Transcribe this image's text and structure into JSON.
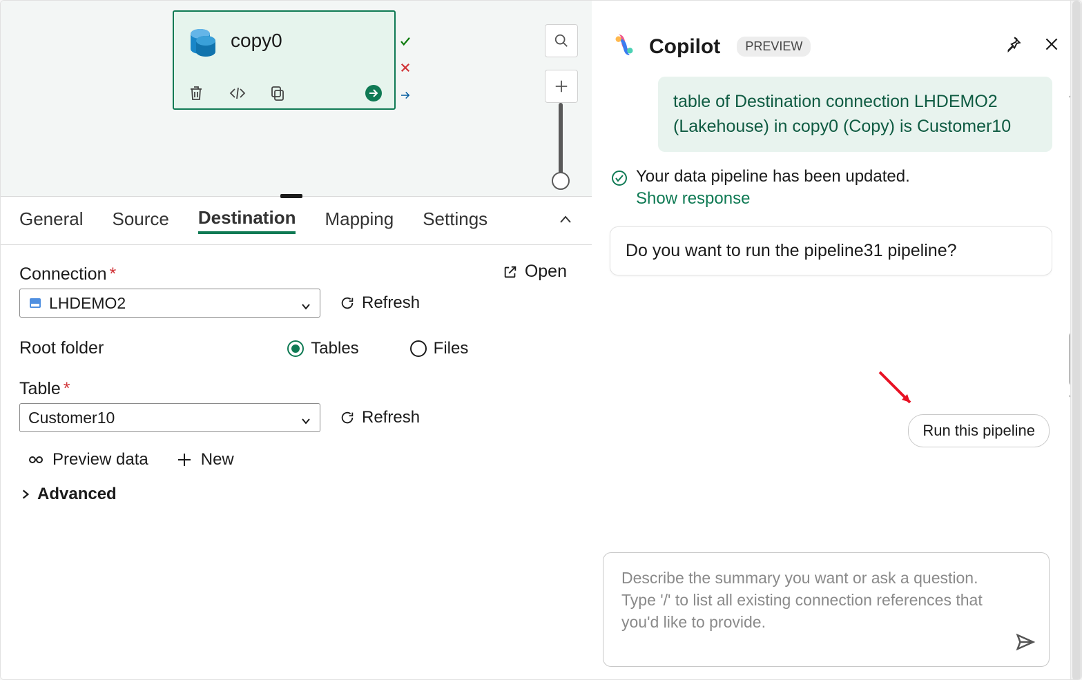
{
  "canvas": {
    "activity_name": "copy0"
  },
  "tabs": {
    "items": [
      "General",
      "Source",
      "Destination",
      "Mapping",
      "Settings"
    ],
    "active_index": 2
  },
  "dest": {
    "connection_label": "Connection",
    "connection_value": "LHDEMO2",
    "refresh_label": "Refresh",
    "open_label": "Open",
    "root_folder_label": "Root folder",
    "root_tables": "Tables",
    "root_files": "Files",
    "table_label": "Table",
    "table_value": "Customer10",
    "preview_label": "Preview data",
    "new_label": "New",
    "advanced_label": "Advanced"
  },
  "copilot": {
    "title": "Copilot",
    "badge": "PREVIEW",
    "green_bubble": "table of Destination connection LHDEMO2 (Lakehouse) in copy0 (Copy) is Customer10",
    "status_text": "Your data pipeline has been updated.",
    "show_response": "Show response",
    "white_bubble": "Do you want to run the pipeline31 pipeline?",
    "run_label": "Run this pipeline",
    "input_placeholder": "Describe the summary you want or ask a question.\nType '/' to list all existing connection references that you'd like to provide."
  }
}
